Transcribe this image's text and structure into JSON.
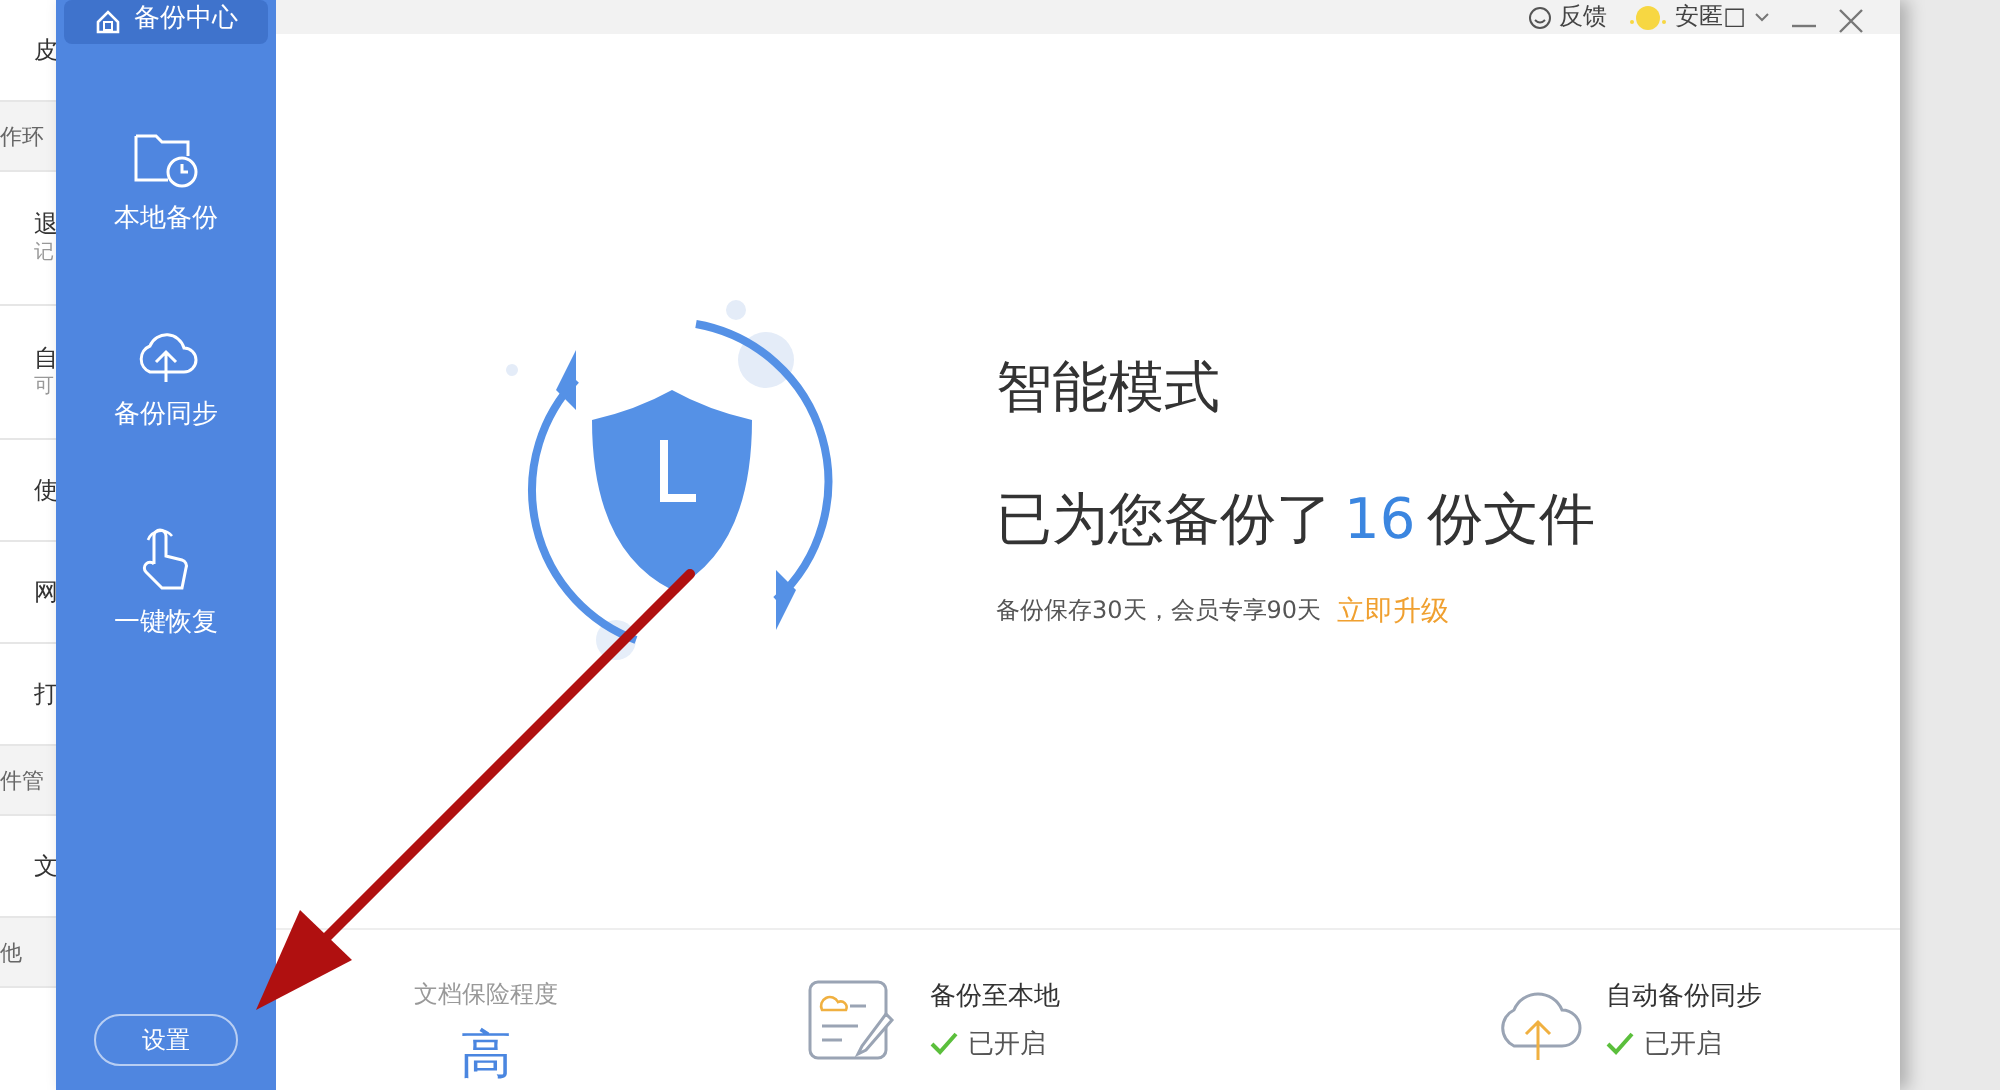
{
  "background_list": {
    "items": [
      {
        "kind": "row",
        "label": "皮"
      },
      {
        "kind": "section",
        "label": "作环"
      },
      {
        "kind": "row",
        "label": "退",
        "sub": "记"
      },
      {
        "kind": "row",
        "label": "自",
        "sub": "可"
      },
      {
        "kind": "row",
        "label": "使"
      },
      {
        "kind": "row",
        "label": "网"
      },
      {
        "kind": "row",
        "label": "打"
      },
      {
        "kind": "section",
        "label": "件管"
      },
      {
        "kind": "row",
        "label": "文"
      },
      {
        "kind": "section",
        "label": "他"
      }
    ]
  },
  "sidebar": {
    "items": [
      {
        "kind": "center",
        "label": "备份中心",
        "selected": true
      },
      {
        "kind": "local",
        "label": "本地备份",
        "selected": false
      },
      {
        "kind": "sync",
        "label": "备份同步",
        "selected": false
      },
      {
        "kind": "restore",
        "label": "一键恢复",
        "selected": false
      }
    ],
    "settings_button": "设置"
  },
  "title_bar": {
    "feedback": "反馈",
    "user": "安匿□"
  },
  "hero": {
    "mode": "智能模式",
    "count_prefix": "已为您备份了",
    "count": "16",
    "count_suffix": "份文件",
    "note": "备份保存30天，会员专享90天",
    "upgrade_link": "立即升级"
  },
  "bottom": {
    "level_label": "文档保险程度",
    "level_value": "高",
    "features": [
      {
        "kind": "local",
        "title": "备份至本地",
        "status": "已开启",
        "enabled": true
      },
      {
        "kind": "sync",
        "title": "自动备份同步",
        "status": "已开启",
        "enabled": true
      }
    ]
  }
}
